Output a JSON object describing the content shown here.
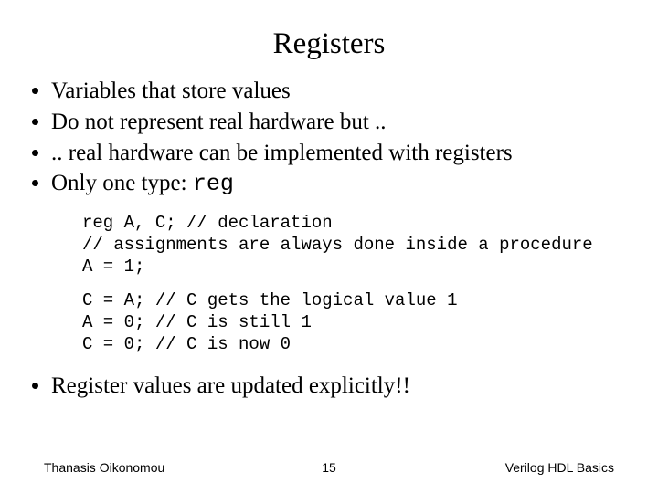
{
  "title": "Registers",
  "bullets1": [
    "Variables that store values",
    "Do not represent real hardware but ..",
    ".. real hardware can be implemented with registers"
  ],
  "bullet_only_type_prefix": "Only one type: ",
  "bullet_only_type_code": "reg",
  "code1": "reg A, C; // declaration\n// assignments are always done inside a procedure\nA = 1;",
  "code2": "C = A; // C gets the logical value 1\nA = 0; // C is still 1\nC = 0; // C is now 0",
  "bullet_last": "Register values are updated explicitly!!",
  "footer": {
    "left": "Thanasis Oikonomou",
    "center": "15",
    "right": "Verilog HDL Basics"
  }
}
